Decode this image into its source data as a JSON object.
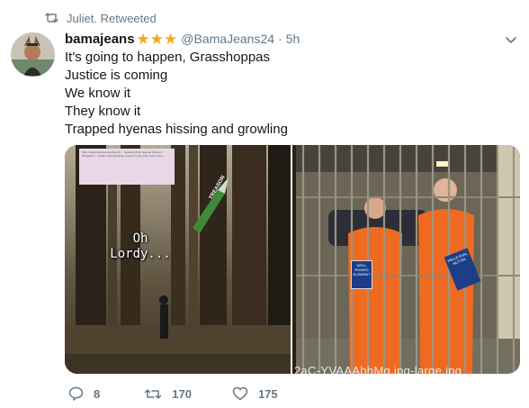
{
  "retweet_banner": {
    "text": "Juliet. Retweeted",
    "icon": "retweet-icon"
  },
  "tweet": {
    "display_name": "bamajeans",
    "stars": [
      "★",
      "★",
      "★"
    ],
    "handle": "@BamaJeans24",
    "separator": "·",
    "timestamp": "5h",
    "menu_icon": "chevron-down-icon",
    "lines": [
      "It's going to happen, Grasshoppas",
      "Justice is coming",
      "We know it",
      "They know it",
      "Trapped hyenas hissing and growling"
    ]
  },
  "media": {
    "left_image": {
      "caption": "Oh Lordy...",
      "missile_label": "TREASON",
      "note_text": "https://www.thenews.com/jan-26 ... treason/pizza/ hyenas/ #Qanon / Pizzagate / ...Public understanding of events / just around the corner"
    },
    "right_image": {
      "filename": "2aC-YVAAAbhMg.jpg-large.jpg",
      "book_left_text": "WELL RUINED ELEMENT",
      "book_right_text": "PELLE EVAL NUTTIN"
    }
  },
  "actions": {
    "reply": {
      "icon": "reply-icon",
      "count": "8"
    },
    "retweet": {
      "icon": "retweet-icon",
      "count": "170"
    },
    "like": {
      "icon": "heart-icon",
      "count": "175"
    }
  },
  "colors": {
    "text_primary": "#14171a",
    "text_secondary": "#657786",
    "star": "#f4a623",
    "action_icons": "#657786"
  }
}
